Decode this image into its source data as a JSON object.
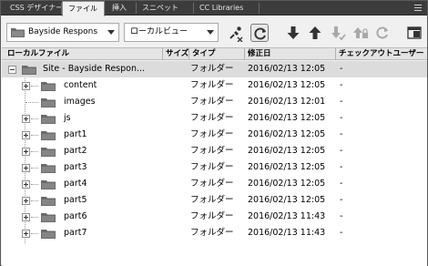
{
  "tabs": [
    {
      "label": "CSS デザイナー",
      "active": false
    },
    {
      "label": "ファイル",
      "active": true
    },
    {
      "label": "挿入",
      "active": false
    },
    {
      "label": "スニペット",
      "active": false
    },
    {
      "label": "CC Libraries",
      "active": false
    }
  ],
  "toolbar": {
    "site_select": "Bayside Respons",
    "view_select": "ローカルビュー",
    "icons": [
      "disconnect-icon",
      "refresh-icon",
      "get-arrow-icon",
      "put-arrow-icon",
      "check-out-icon",
      "check-in-icon",
      "sync-icon",
      "expand-icon"
    ]
  },
  "columns": {
    "name": "ローカルファイル",
    "size": "サイズ",
    "type": "タイプ",
    "modified": "修正日",
    "checked_out": "チェックアウトユーザー"
  },
  "rows": [
    {
      "name": "Site - Bayside Respon...",
      "type": "フォルダー",
      "modified": "2016/02/13 12:05",
      "checked_out": "-",
      "expander": "minus"
    },
    {
      "name": "content",
      "type": "フォルダー",
      "modified": "2016/02/13 12:05",
      "checked_out": "-",
      "expander": "plus"
    },
    {
      "name": "images",
      "type": "フォルダー",
      "modified": "2016/02/13 12:01",
      "checked_out": "-",
      "expander": "none"
    },
    {
      "name": "js",
      "type": "フォルダー",
      "modified": "2016/02/13 12:05",
      "checked_out": "-",
      "expander": "plus"
    },
    {
      "name": "part1",
      "type": "フォルダー",
      "modified": "2016/02/13 12:05",
      "checked_out": "-",
      "expander": "plus"
    },
    {
      "name": "part2",
      "type": "フォルダー",
      "modified": "2016/02/13 12:05",
      "checked_out": "-",
      "expander": "plus"
    },
    {
      "name": "part3",
      "type": "フォルダー",
      "modified": "2016/02/13 12:05",
      "checked_out": "-",
      "expander": "plus"
    },
    {
      "name": "part4",
      "type": "フォルダー",
      "modified": "2016/02/13 12:05",
      "checked_out": "-",
      "expander": "plus"
    },
    {
      "name": "part5",
      "type": "フォルダー",
      "modified": "2016/02/13 12:05",
      "checked_out": "-",
      "expander": "plus"
    },
    {
      "name": "part6",
      "type": "フォルダー",
      "modified": "2016/02/13 11:43",
      "checked_out": "-",
      "expander": "plus"
    },
    {
      "name": "part7",
      "type": "フォルダー",
      "modified": "2016/02/13 11:43",
      "checked_out": "-",
      "expander": "plus"
    }
  ],
  "colors": {
    "tabbar": "#3c3c3c",
    "selected_row": "#dcdcdc",
    "folder": "#6b6b6b"
  }
}
